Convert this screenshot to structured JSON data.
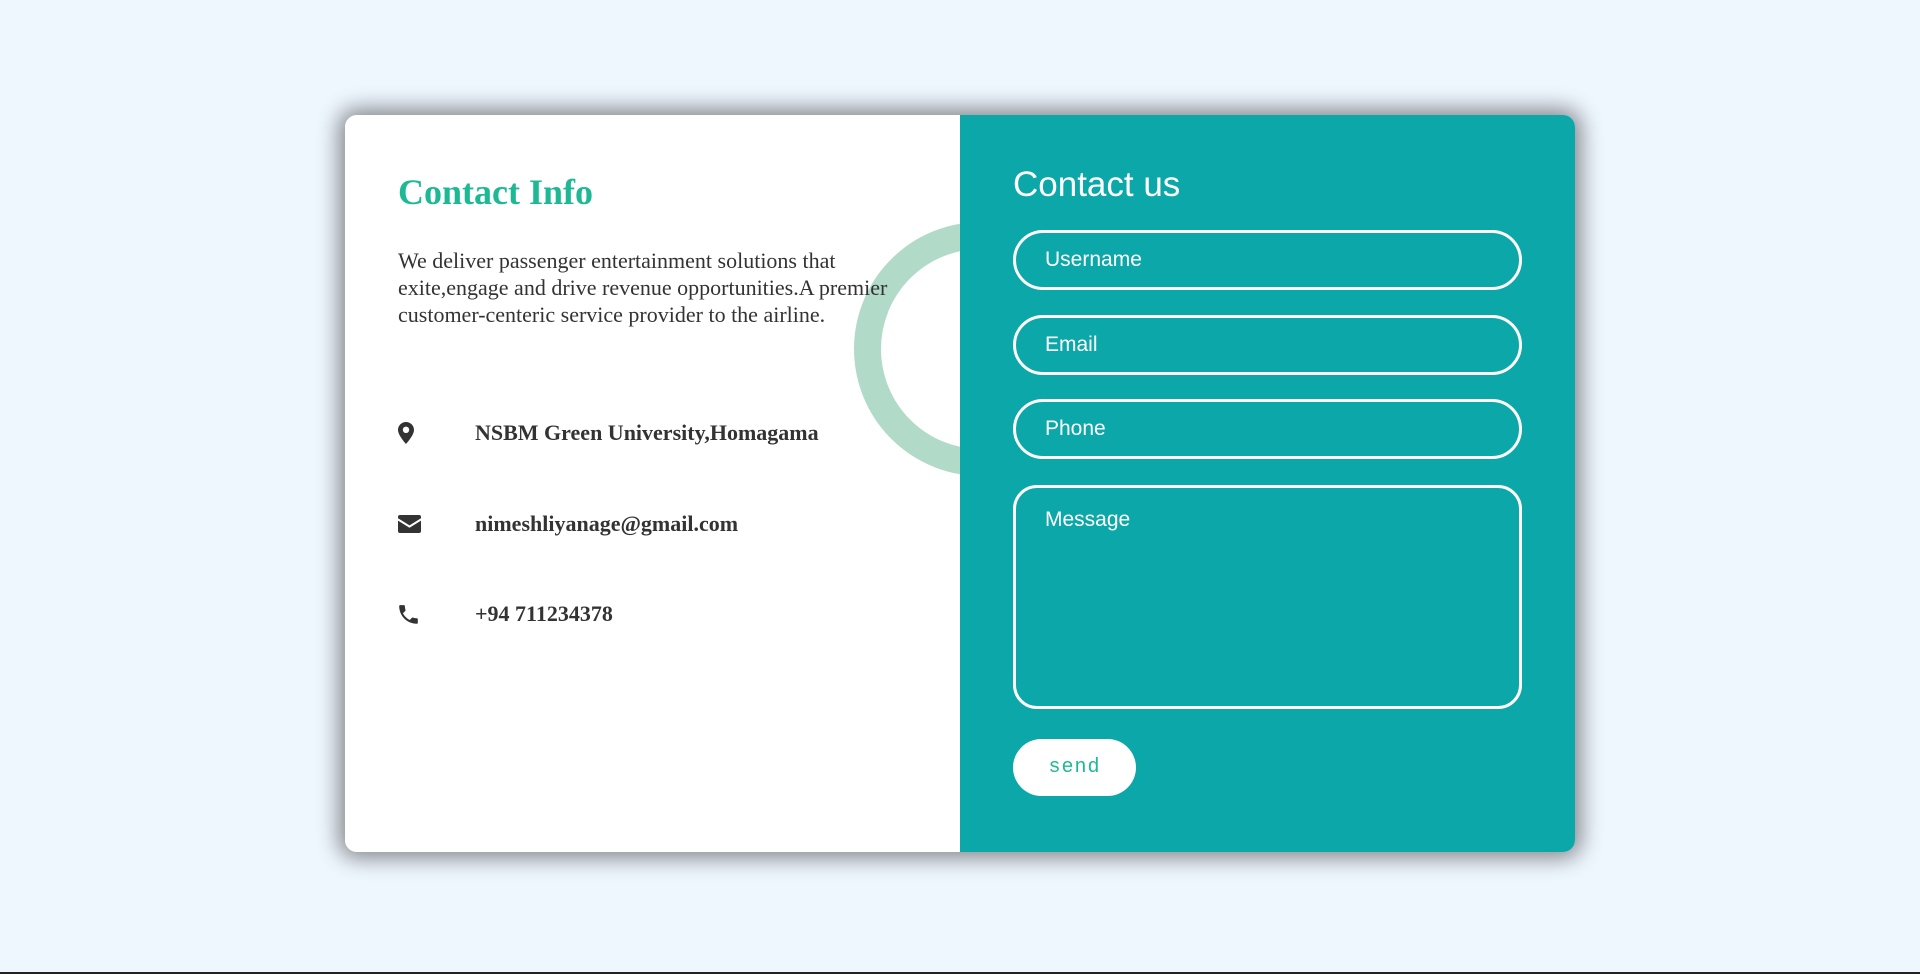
{
  "info": {
    "title": "Contact Info",
    "description": "We deliver passenger entertainment solutions that exite,engage and drive revenue opportunities.A premier customer-centeric service provider to the airline.",
    "items": [
      {
        "icon": "map-pin-icon",
        "text": "NSBM Green University,Homagama"
      },
      {
        "icon": "envelope-icon",
        "text": "nimeshliyanage@gmail.com"
      },
      {
        "icon": "phone-icon",
        "text": "+94 711234378"
      }
    ]
  },
  "form": {
    "title": "Contact us",
    "fields": {
      "username": {
        "placeholder": "Username",
        "value": ""
      },
      "email": {
        "placeholder": "Email",
        "value": ""
      },
      "phone": {
        "placeholder": "Phone",
        "value": ""
      },
      "message": {
        "placeholder": "Message",
        "value": ""
      }
    },
    "submit_label": "send"
  },
  "colors": {
    "page_background": "#eef6fe",
    "accent_green": "#1db994",
    "form_teal": "#0ca7a8",
    "ring_mint": "#b1dac8",
    "text_dark": "#333333"
  }
}
